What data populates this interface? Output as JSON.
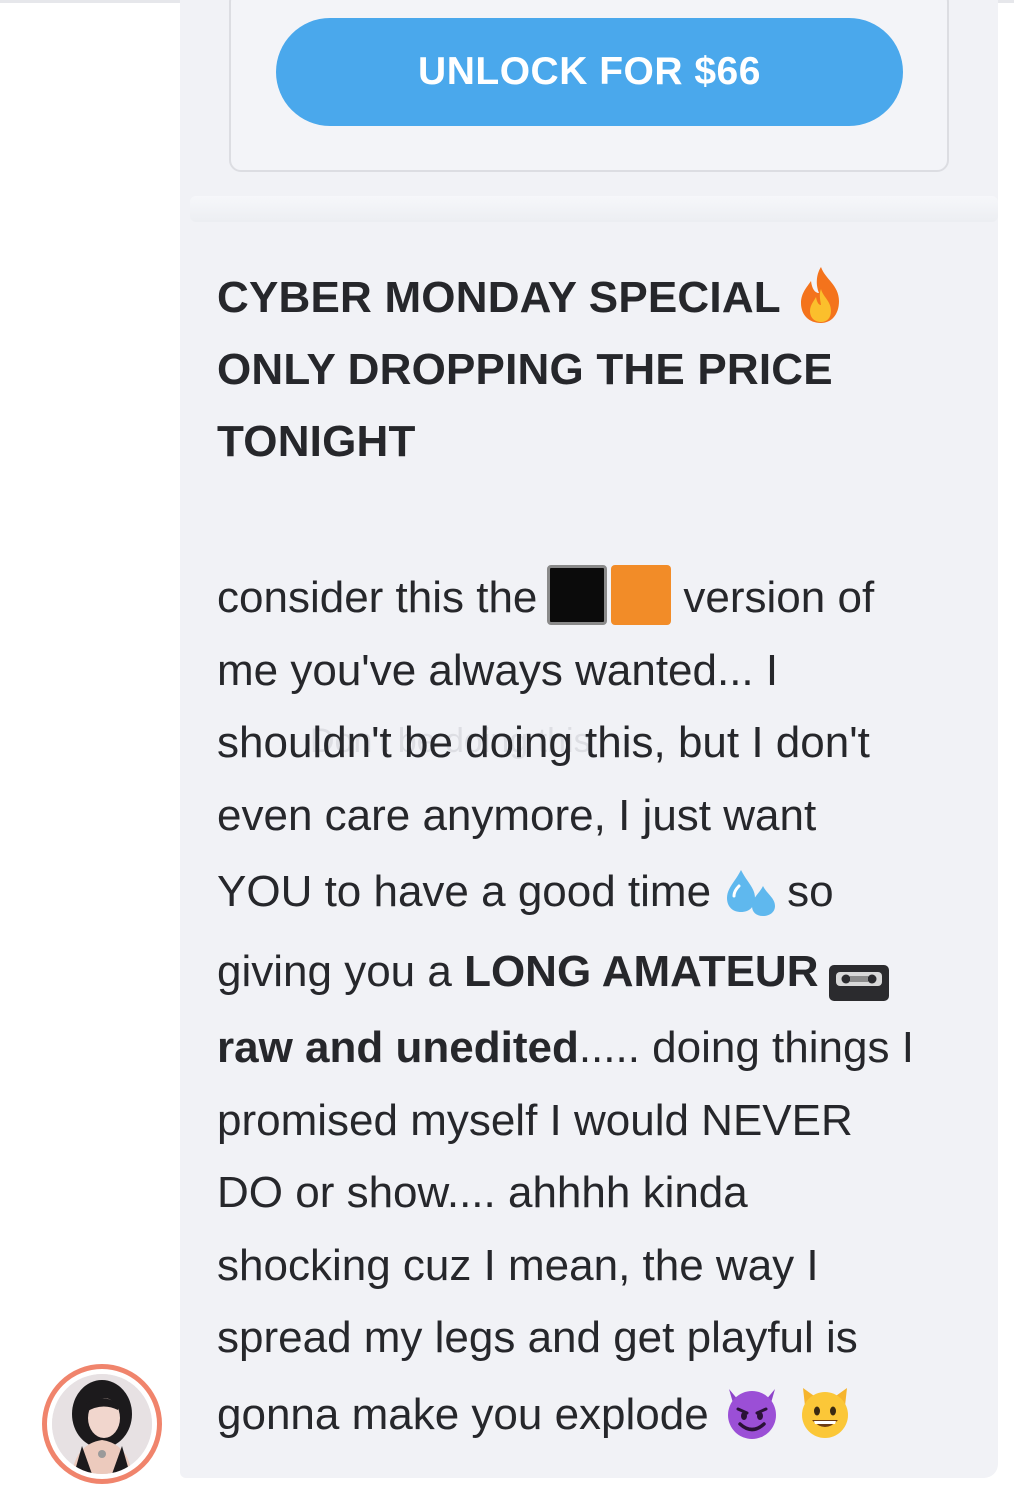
{
  "unlock": {
    "button_label": "UNLOCK FOR $66"
  },
  "message": {
    "headline": [
      "CYBER MONDAY SPECIAL",
      "ONLY DROPPING THE PRICE",
      "TONIGHT"
    ],
    "body": {
      "l1_a": "consider this the",
      "l1_b": "version of",
      "l2": "me you've always wanted... I",
      "l3": "shouldn't be doing this, but I don't",
      "l4": "even care anymore, I just want",
      "l5": "YOU to have a good time",
      "l5_b": "so",
      "l6_a": "giving you a",
      "l6_bold": "LONG AMATEUR",
      "l7_bold": "raw and unedited",
      "l7_b": "..... doing things I",
      "l8": "promised myself I would NEVER",
      "l9": "DO or show.... ahhhh kinda",
      "l10": "shocking cuz I mean, the way I",
      "l11": "spread my legs and get playful is",
      "l12": "gonna make you explode"
    },
    "emojis": {
      "headline": "fire-emoji",
      "l1": [
        "black-square-emoji",
        "orange-square-emoji"
      ],
      "l5": "sweat-droplets-emoji",
      "l6": "videocassette-emoji",
      "l12": [
        "smiling-devil-emoji",
        "grinning-cat-emoji"
      ]
    },
    "watermark": "Don't be doing this"
  },
  "colors": {
    "unlock_button": "#4aa8ec",
    "bubble_background": "#f1f2f6",
    "avatar_ring": "#f0846c",
    "text": "#26272b"
  }
}
